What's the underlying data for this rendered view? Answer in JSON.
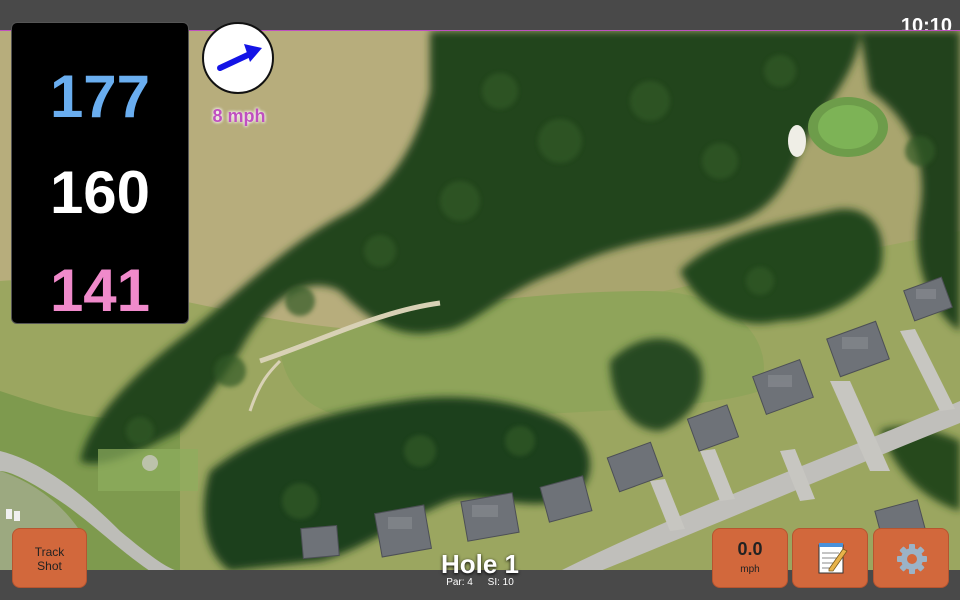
{
  "status": {
    "time": "10:10"
  },
  "distances": {
    "back": "177",
    "middle": "160",
    "front": "141"
  },
  "wind": {
    "speed_label": "8 mph",
    "direction": "arrow-right-up"
  },
  "hole": {
    "title": "Hole 1",
    "par": "Par: 4",
    "stroke_index": "SI: 10"
  },
  "buttons": {
    "track_shot_line1": "Track",
    "track_shot_line2": "Shot",
    "wind_value": "0.0",
    "wind_unit": "mph",
    "notes_icon": "notepad-icon",
    "settings_icon": "gear-icon"
  },
  "colors": {
    "back": "#6aaef0",
    "middle": "#ffffff",
    "front": "#f08acb",
    "button": "#d2683c",
    "wind_text": "#c050c0"
  }
}
